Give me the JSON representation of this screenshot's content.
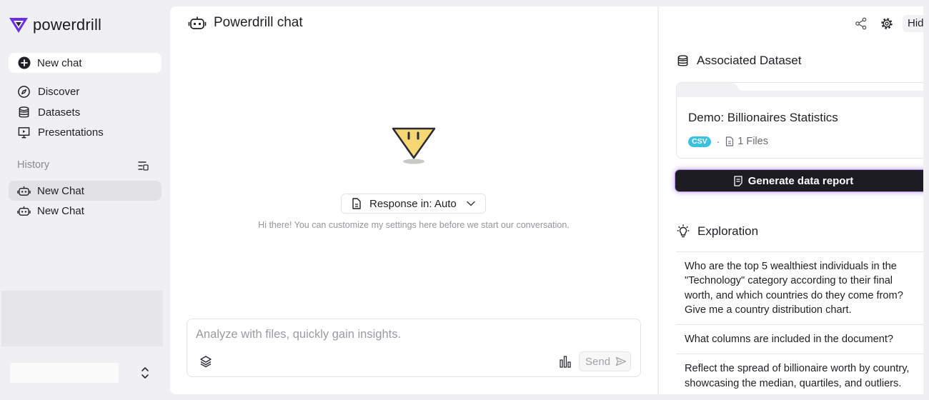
{
  "sidebar": {
    "logo_text": "powerdrill",
    "new_chat": "New chat",
    "nav": {
      "discover": "Discover",
      "datasets": "Datasets",
      "presentations": "Presentations"
    },
    "history_label": "History",
    "history": [
      "New Chat",
      "New Chat"
    ]
  },
  "main": {
    "title": "Powerdrill chat",
    "response_label": "Response in: Auto",
    "hint": "Hi there! You can customize my settings here before we start our conversation.",
    "composer": {
      "placeholder": "Analyze with files, quickly gain insights.",
      "send": "Send"
    }
  },
  "right_panel": {
    "hide": "Hide",
    "associated_title": "Associated Dataset",
    "dataset": {
      "name": "Demo: Billionaires Statistics",
      "badge": "CSV",
      "files": "1 Files"
    },
    "report_button": "Generate data report",
    "exploration_title": "Exploration",
    "questions": [
      "Who are the top 5 wealthiest individuals in the \"Technology\" category according to their final worth, and which countries do they come from? Give me a country distribution chart.",
      "What columns are included in the document?",
      "Reflect the spread of billionaire worth by country, showcasing the median, quartiles, and outliers."
    ]
  },
  "colors": {
    "brand_purple": "#6a2ee8",
    "mascot_yellow": "#f7d774",
    "csv_badge": "#3cc0df",
    "report_button": "#1d1c22",
    "sidebar_bg": "#f0f0f2"
  }
}
